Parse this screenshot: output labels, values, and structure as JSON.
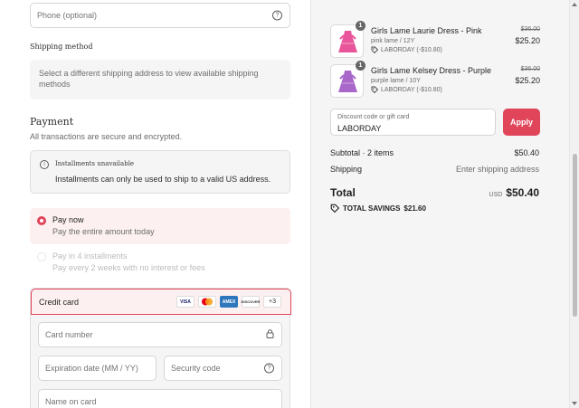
{
  "contact": {
    "phone_placeholder": "Phone (optional)"
  },
  "shipping_method": {
    "title": "Shipping method",
    "message": "Select a different shipping address to view available shipping methods"
  },
  "payment": {
    "title": "Payment",
    "subtitle": "All transactions are secure and encrypted.",
    "installments_notice": {
      "title": "Installments unavailable",
      "text": "Installments can only be used to ship to a valid US address."
    },
    "options": [
      {
        "label": "Pay now",
        "description": "Pay the entire amount today",
        "selected": true
      },
      {
        "label": "Pay in 4 installments",
        "description": "Pay every 2 weeks with no interest or fees",
        "selected": false
      }
    ],
    "credit_card": {
      "label": "Credit card",
      "brands": [
        "VISA",
        "MC",
        "AMEX",
        "DISCOVER"
      ],
      "more_brands": "+3",
      "card_number_placeholder": "Card number",
      "expiration_placeholder": "Expiration date (MM / YY)",
      "security_code_placeholder": "Security code",
      "name_placeholder": "Name on card"
    }
  },
  "order": {
    "items": [
      {
        "quantity": "1",
        "name": "Girls Lame Laurie Dress - Pink",
        "variant": "pink lame / 12Y",
        "discount": "LABORDAY (-$10.80)",
        "original_price": "$36.00",
        "price": "$25.20",
        "color": "#e8559a"
      },
      {
        "quantity": "1",
        "name": "Girls Lame Kelsey Dress - Purple",
        "variant": "purple lame / 10Y",
        "discount": "LABORDAY (-$10.80)",
        "original_price": "$36.00",
        "price": "$25.20",
        "color": "#a867c9"
      }
    ],
    "discount_field": {
      "label": "Discount code or gift card",
      "value": "LABORDAY",
      "apply_label": "Apply"
    },
    "subtotal_label": "Subtotal · 2 items",
    "subtotal_value": "$50.40",
    "shipping_label": "Shipping",
    "shipping_value": "Enter shipping address",
    "total_label": "Total",
    "currency": "USD",
    "total_value": "$50.40",
    "savings_label": "TOTAL SAVINGS",
    "savings_value": "$21.60"
  },
  "colors": {
    "accent": "#e0455a",
    "panel": "#f5f5f5"
  }
}
